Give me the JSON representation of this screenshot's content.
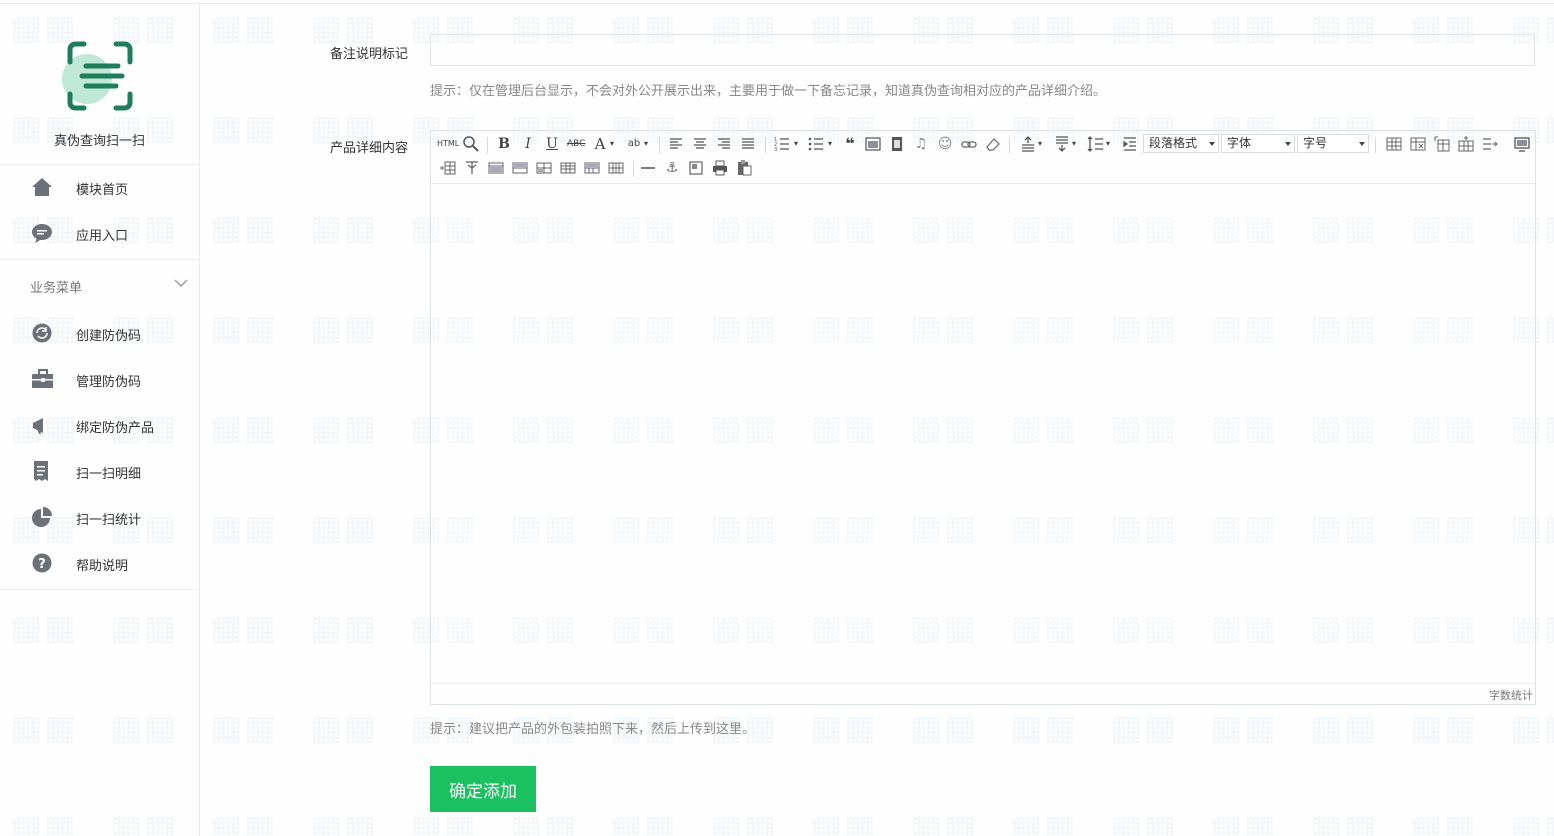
{
  "app": {
    "title": "真伪查询扫一扫"
  },
  "nav": {
    "top_items": [
      {
        "label": "模块首页",
        "icon": "home-icon"
      },
      {
        "label": "应用入口",
        "icon": "chat-bubble-icon"
      }
    ],
    "section_title": "业务菜单",
    "section_items": [
      {
        "label": "创建防伪码",
        "icon": "refresh-circle-icon"
      },
      {
        "label": "管理防伪码",
        "icon": "briefcase-icon"
      },
      {
        "label": "绑定防伪产品",
        "icon": "megaphone-icon"
      },
      {
        "label": "扫一扫明细",
        "icon": "receipt-icon"
      },
      {
        "label": "扫一扫统计",
        "icon": "pie-chart-icon"
      },
      {
        "label": "帮助说明",
        "icon": "question-circle-icon"
      }
    ]
  },
  "form": {
    "remark_label": "备注说明标记",
    "remark_value": "",
    "remark_hint": "提示：仅在管理后台显示，不会对外公开展示出来，主要用于做一下备忘记录，知道真伪查询相对应的产品详细介绍。",
    "detail_label": "产品详细内容",
    "detail_hint": "提示：建议把产品的外包装拍照下来，然后上传到这里。",
    "submit_label": "确定添加"
  },
  "editor": {
    "html_label": "HTML",
    "paragraph_select": "段落格式",
    "font_select": "字体",
    "size_select": "字号",
    "word_count_label": "字数统计"
  },
  "colors": {
    "accent": "#1bc061",
    "logo": "#1e7d5c",
    "logo_bg": "#bfe9d6"
  }
}
